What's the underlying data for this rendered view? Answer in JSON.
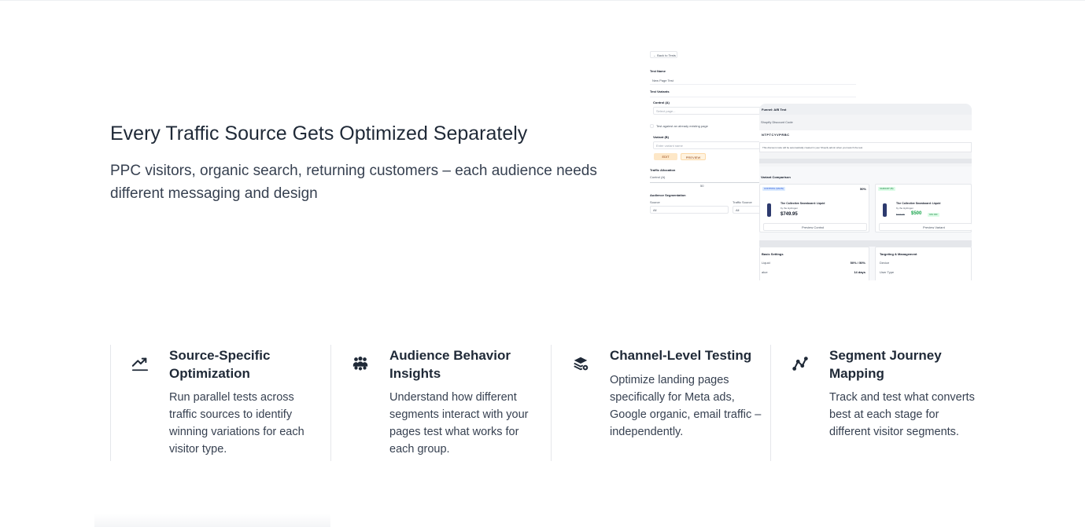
{
  "hero": {
    "title": "Every Traffic Source Gets Optimized Separately",
    "subtitle": "PPC visitors, organic search, returning customers – each audience needs different messaging and design"
  },
  "mock": {
    "back": "← Back to Tests",
    "test_name_label": "Test Name",
    "test_name_value": "New Page Test",
    "variants_label": "Test Variants",
    "control_label": "Control (A)",
    "control_placeholder": "Select page...",
    "already_existing": "Test against an already existing page",
    "variant_label": "Variant (B)",
    "variant_placeholder": "Enter variant name",
    "edit_btn": "EDIT",
    "preview_btn": "PREVIEW",
    "traffic_label": "Traffic Allocation",
    "control_pct_label": "Control (A)",
    "traffic_value": "50",
    "segmentation_label": "Audience Segmentation",
    "source_label": "Source",
    "source_value": "All",
    "traffic_source_label": "Traffic Source",
    "traffic_source_value": "All",
    "panel_title": "Funnel: A/B Test",
    "discount_label": "Shopify Discount Code",
    "discount_code": "NTPTCYVPRBC",
    "discount_note": "This discount code will be automatically created in your Shopify admin when you launch the test.",
    "comparison_label": "Variant Comparison",
    "control_badge": "CONTROL (MAIN)",
    "control_pct": "50%",
    "variant_badge": "VARIANT (B)",
    "product_name": "The Collective Snowboard: Liquid",
    "product_vendor": "by the Hydrogen",
    "control_price": "$749.95",
    "variant_old_price": "$749.95",
    "variant_price": "$500",
    "variant_off": "33% OFF",
    "preview_control": "Preview Control",
    "preview_variant": "Preview Variant",
    "settings_label": "Basic Settings",
    "liquid_label": "Liquid",
    "split_value": "50% / 50%",
    "value_label": "alue",
    "days_value": "14 days",
    "targeting_label": "Targeting & Management",
    "device_label": "Device",
    "user_type_label": "User Type"
  },
  "features": [
    {
      "icon": "trending-up-icon",
      "title": "Source-Specific Optimization",
      "description": "Run parallel tests across traffic sources to identify winning variations for each visitor type."
    },
    {
      "icon": "users-group-icon",
      "title": "Audience Behavior Insights",
      "description": "Understand how different segments interact with your pages test what works for each group."
    },
    {
      "icon": "layers-gear-icon",
      "title": "Channel-Level Testing",
      "description": "Optimize landing pages specifically for Meta ads, Google organic, email traffic – independently."
    },
    {
      "icon": "journey-path-icon",
      "title": "Segment Journey Mapping",
      "description": "Track and test what converts best at each stage for different visitor segments."
    }
  ],
  "colors": {
    "text": "#1f2937",
    "muted": "#374151",
    "divider": "#e5e7eb",
    "accent_green": "#16a34a",
    "accent_blue": "#1d4ed8"
  }
}
